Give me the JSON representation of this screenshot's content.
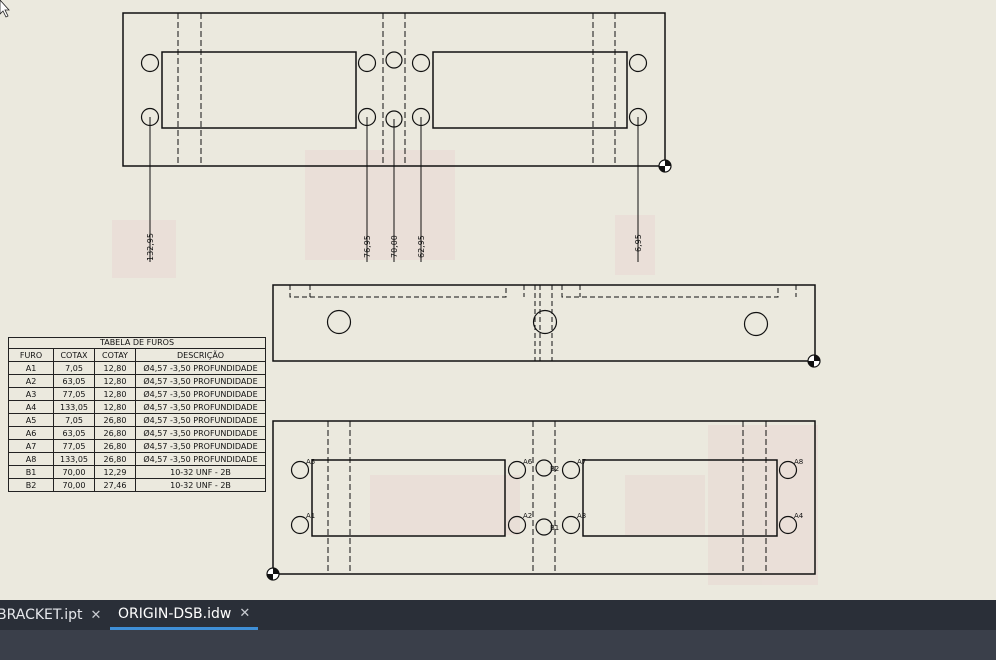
{
  "drawing": {
    "dims_top": [
      "132,95",
      "76,95",
      "70,00",
      "62,95",
      "6,95"
    ],
    "hole_labels": [
      "A5",
      "A6",
      "A7",
      "A8",
      "A1",
      "A2",
      "A3",
      "A4",
      "B1",
      "B2"
    ]
  },
  "hole_table": {
    "title": "TABELA DE FUROS",
    "headers": [
      "FURO",
      "COTAX",
      "COTAY",
      "DESCRIÇÃO"
    ],
    "rows": [
      [
        "A1",
        "7,05",
        "12,80",
        "Ø4,57 -3,50 PROFUNDIDADE"
      ],
      [
        "A2",
        "63,05",
        "12,80",
        "Ø4,57 -3,50 PROFUNDIDADE"
      ],
      [
        "A3",
        "77,05",
        "12,80",
        "Ø4,57 -3,50 PROFUNDIDADE"
      ],
      [
        "A4",
        "133,05",
        "12,80",
        "Ø4,57 -3,50 PROFUNDIDADE"
      ],
      [
        "A5",
        "7,05",
        "26,80",
        "Ø4,57 -3,50 PROFUNDIDADE"
      ],
      [
        "A6",
        "63,05",
        "26,80",
        "Ø4,57 -3,50 PROFUNDIDADE"
      ],
      [
        "A7",
        "77,05",
        "26,80",
        "Ø4,57 -3,50 PROFUNDIDADE"
      ],
      [
        "A8",
        "133,05",
        "26,80",
        "Ø4,57 -3,50 PROFUNDIDADE"
      ],
      [
        "B1",
        "70,00",
        "12,29",
        "10-32 UNF - 2B"
      ],
      [
        "B2",
        "70,00",
        "27,46",
        "10-32 UNF - 2B"
      ]
    ]
  },
  "tabs": [
    {
      "label": "BRACKET.ipt",
      "close": "✕"
    },
    {
      "label": "ORIGIN-DSB.idw",
      "close": "✕"
    }
  ],
  "icons": [
    "close-icon",
    "origin-marker-icon",
    "mouse-cursor-icon"
  ],
  "colors": {
    "sheet": "#ebe9de",
    "tabbar": "#2a2f38",
    "active_tab_underline": "#3f8fd6"
  }
}
